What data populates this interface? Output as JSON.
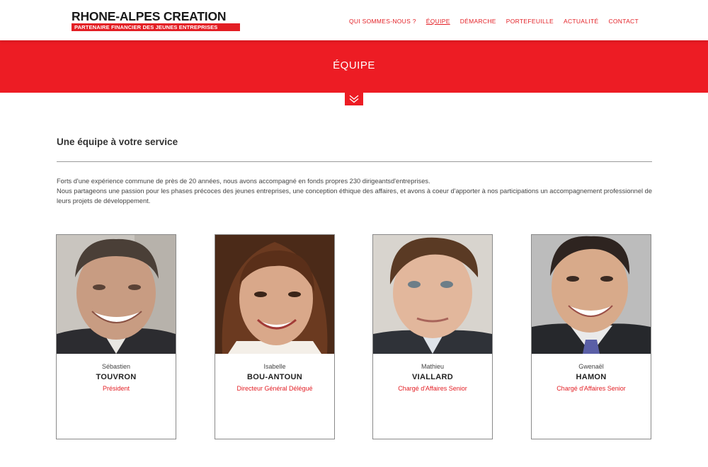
{
  "logo": {
    "title": "RHONE-ALPES CREATION",
    "subtitle": "PARTENAIRE FINANCIER DES JEUNES ENTREPRISES"
  },
  "nav": {
    "items": [
      "QUI SOMMES-NOUS ?",
      "ÉQUIPE",
      "DÉMARCHE",
      "PORTEFEUILLE",
      "ACTUALITÉ",
      "CONTACT"
    ],
    "active": "ÉQUIPE"
  },
  "banner": {
    "title": "ÉQUIPE"
  },
  "section": {
    "title": "Une équipe à votre service",
    "paragraphs": [
      "Forts d'une expérience commune de près de 20 années, nous avons accompagné en fonds propres 230 dirigeantsd'entreprises.",
      "Nous partageons une passion pour les phases précoces des jeunes entreprises, une conception éthique des affaires, et avons à coeur d'apporter à nos participations un accompagnement professionnel de leurs projets de développement."
    ]
  },
  "team": [
    {
      "first_name": "Sébastien",
      "last_name": "TOUVRON",
      "role": "Président"
    },
    {
      "first_name": "Isabelle",
      "last_name": "BOU-ANTOUN",
      "role": "Directeur Général Délégué"
    },
    {
      "first_name": "Mathieu",
      "last_name": "VIALLARD",
      "role": "Chargé d'Affaires Senior"
    },
    {
      "first_name": "Gwenaël",
      "last_name": "HAMON",
      "role": "Chargé d'Affaires Senior"
    }
  ],
  "colors": {
    "brand_red": "#ed1c24",
    "text_dark": "#333333"
  },
  "icons": {
    "banner_toggle": "double-chevron-down-icon"
  }
}
